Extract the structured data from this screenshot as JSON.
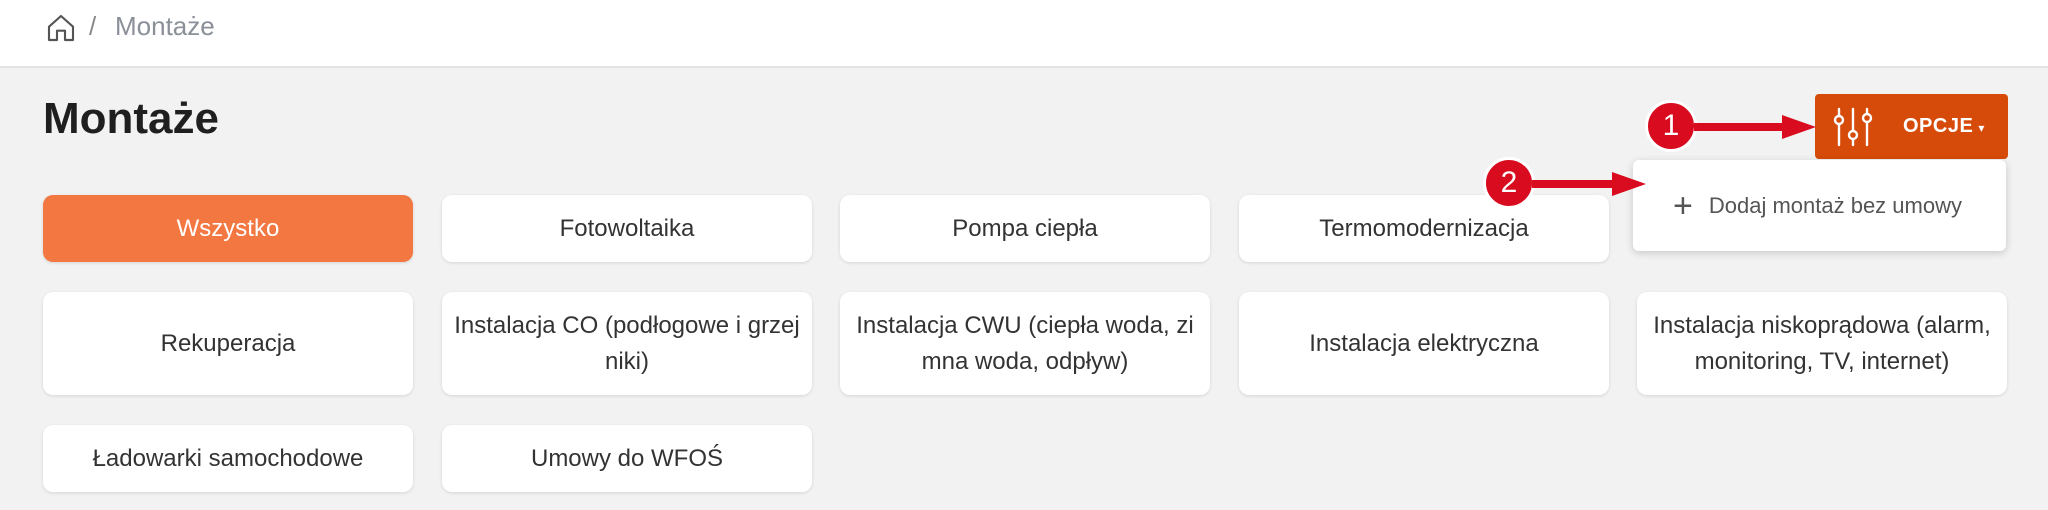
{
  "breadcrumb": {
    "separator": "/",
    "current": "Montaże"
  },
  "page": {
    "title": "Montaże"
  },
  "options": {
    "label": "OPCJE",
    "caret": "▾"
  },
  "dropdown": {
    "plus": "+",
    "label": "Dodaj montaż bez umowy"
  },
  "annotations": {
    "one": "1",
    "two": "2"
  },
  "categories": [
    {
      "label": "Wszystko",
      "active": true
    },
    {
      "label": "Fotowoltaika"
    },
    {
      "label": "Pompa ciepła"
    },
    {
      "label": "Termomodernizacja"
    },
    {
      "label": "Rekuperacja"
    },
    {
      "label": "Instalacja CO (podłogowe i grzejniki)"
    },
    {
      "label": "Instalacja CWU (ciepła woda, zimna woda, odpływ)"
    },
    {
      "label": "Instalacja elektryczna"
    },
    {
      "label": "Instalacja niskoprądowa (alarm, monitoring, TV, internet)"
    },
    {
      "label": "Ładowarki samochodowe"
    },
    {
      "label": "Umowy do WFOŚ"
    }
  ],
  "colors": {
    "accent": "#f37741",
    "options": "#d64b0a",
    "annotation": "#d90b1e"
  }
}
